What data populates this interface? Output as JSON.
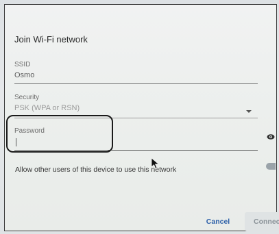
{
  "dialog": {
    "title": "Join Wi-Fi network"
  },
  "ssid": {
    "label": "SSID",
    "value": "Osmo"
  },
  "security": {
    "label": "Security",
    "value": "PSK (WPA or RSN)"
  },
  "password": {
    "label": "Password",
    "value": ""
  },
  "share": {
    "label": "Allow other users of this device to use this network",
    "enabled": false
  },
  "buttons": {
    "cancel": "Cancel",
    "connect": "Connect"
  },
  "icons": {
    "visibility": "eye-icon",
    "dropdown": "chevron-down-icon",
    "pointer": "mouse-pointer-icon"
  }
}
